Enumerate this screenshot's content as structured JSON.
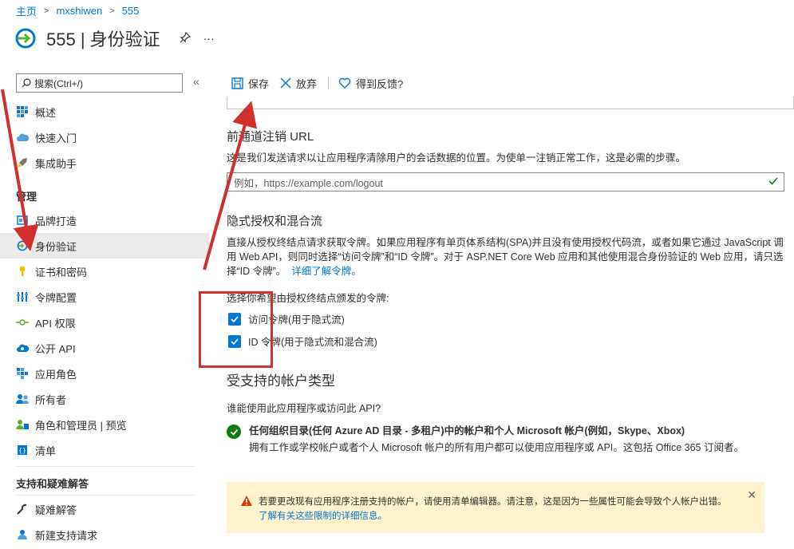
{
  "breadcrumb": {
    "home": "主页",
    "app": "mxshiwen",
    "page": "555"
  },
  "header": {
    "title": "555 | 身份验证",
    "pin_icon": "pin-icon",
    "more": "···"
  },
  "sidebar": {
    "search_placeholder": "搜索(Ctrl+/)",
    "collapse": "«",
    "items_top": [
      {
        "label": "概述",
        "icon": "grid-icon"
      },
      {
        "label": "快速入门",
        "icon": "cloud-icon"
      },
      {
        "label": "集成助手",
        "icon": "rocket-icon"
      }
    ],
    "manage_label": "管理",
    "items_manage": [
      {
        "label": "品牌打造",
        "icon": "branding-icon"
      },
      {
        "label": "身份验证",
        "icon": "auth-icon"
      },
      {
        "label": "证书和密码",
        "icon": "key-icon"
      },
      {
        "label": "令牌配置",
        "icon": "token-config-icon"
      },
      {
        "label": "API 权限",
        "icon": "api-permission-icon"
      },
      {
        "label": "公开 API",
        "icon": "expose-api-icon"
      },
      {
        "label": "应用角色",
        "icon": "app-roles-icon"
      },
      {
        "label": "所有者",
        "icon": "owners-icon"
      },
      {
        "label": "角色和管理员 | 预览",
        "icon": "roles-admins-icon"
      },
      {
        "label": "清单",
        "icon": "manifest-icon"
      }
    ],
    "support_label": "支持和疑难解答",
    "items_support": [
      {
        "label": "疑难解答",
        "icon": "wrench-icon"
      },
      {
        "label": "新建支持请求",
        "icon": "support-person-icon"
      }
    ]
  },
  "toolbar": {
    "save": "保存",
    "discard": "放弃",
    "feedback": "得到反馈?"
  },
  "logout": {
    "title": "前通道注销 URL",
    "desc": "这是我们发送请求以让应用程序清除用户的会话数据的位置。为使单一注销正常工作，这是必需的步骤。",
    "placeholder": "例如，https://example.com/logout"
  },
  "implicit": {
    "title": "隐式授权和混合流",
    "desc": "直接从授权终结点请求获取令牌。如果应用程序有单页体系结构(SPA)并且没有使用授权代码流，或者如果它通过 JavaScript 调用 Web API，则同时选择“访问令牌”和“ID 令牌”。对于 ASP.NET Core Web 应用和其他使用混合身份验证的 Web 应用，请只选择“ID 令牌”。",
    "link": "详细了解令牌。",
    "select_label": "选择你希望由授权终结点颁发的令牌:",
    "checkboxes": [
      {
        "label": "访问令牌(用于隐式流)",
        "checked": true
      },
      {
        "label": "ID 令牌(用于隐式流和混合流)",
        "checked": true
      }
    ]
  },
  "accounts": {
    "title": "受支持的帐户类型",
    "question": "谁能使用此应用程序或访问此 API?",
    "selected_bold": "任何组织目录(任何 Azure AD 目录 - 多租户)中的帐户和个人 Microsoft 帐户(例如，Skype、Xbox)",
    "selected_desc": "拥有工作或学校帐户或者个人 Microsoft 帐户的所有用户都可以使用应用程序或 API。这包括 Office 365 订阅者。"
  },
  "warning": {
    "text": "若要更改现有应用程序注册支持的帐户，请使用清单编辑器。请注意，这是因为一些属性可能会导致个人帐户出错。",
    "link": "了解有关这些限制的详细信息。",
    "close": "✕"
  },
  "colors": {
    "accent": "#0078d4",
    "success": "#107c10",
    "warning_bg": "#fff4ce",
    "annotation": "#d32f2f"
  }
}
